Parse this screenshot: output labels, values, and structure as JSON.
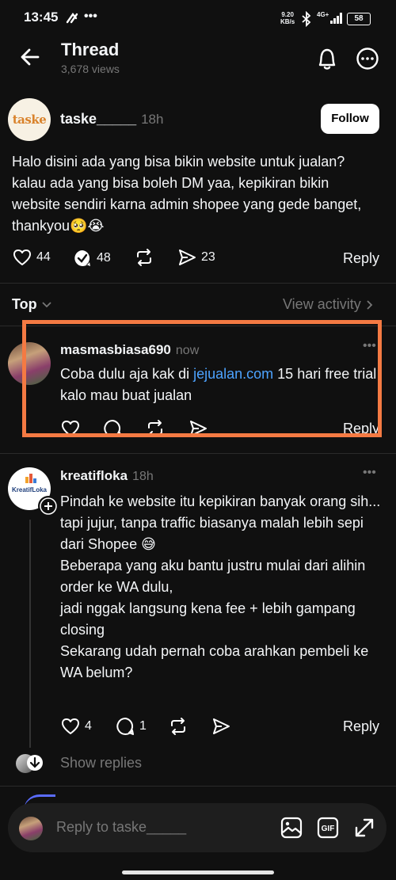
{
  "status": {
    "time": "13:45",
    "speed_value": "9.20",
    "speed_unit": "KB/s",
    "network": "4G+",
    "battery": "58"
  },
  "header": {
    "title": "Thread",
    "views": "3,678 views"
  },
  "post": {
    "avatar_text": "taske",
    "username": "taske_____",
    "time": "18h",
    "follow_label": "Follow",
    "text": "Halo disini ada yang bisa bikin website untuk jualan? kalau ada yang bisa boleh DM yaa, kepikiran bikin website sendiri karna admin shopee yang gede banget, thankyou🥺😭",
    "likes": "44",
    "comments": "48",
    "shares": "23",
    "reply_label": "Reply"
  },
  "sort": {
    "label": "Top",
    "view_activity": "View activity"
  },
  "reply1": {
    "username": "masmasbiasa690",
    "time": "now",
    "text_before": "Coba dulu aja kak di ",
    "link": "jejualan.com",
    "text_after": " 15 hari free trial kalo mau buat jualan",
    "reply_label": "Reply"
  },
  "reply2": {
    "username": "kreatifloka",
    "time": "18h",
    "avatar_text": "KreatifLoka",
    "lines": [
      "Pindah ke website itu kepikiran banyak orang sih...",
      "tapi jujur, tanpa traffic biasanya malah lebih sepi dari Shopee 😅",
      "Beberapa yang aku bantu justru mulai dari alihin order ke WA dulu,",
      "jadi nggak langsung kena fee + lebih gampang closing",
      "Sekarang udah pernah coba arahkan pembeli ke WA belum?"
    ],
    "likes": "4",
    "comments": "1",
    "reply_label": "Reply",
    "show_replies": "Show replies"
  },
  "composer": {
    "placeholder": "Reply to taske_____"
  },
  "colors": {
    "accent_link": "#4da3ff",
    "highlight": "#f47a43",
    "background": "#101010"
  }
}
